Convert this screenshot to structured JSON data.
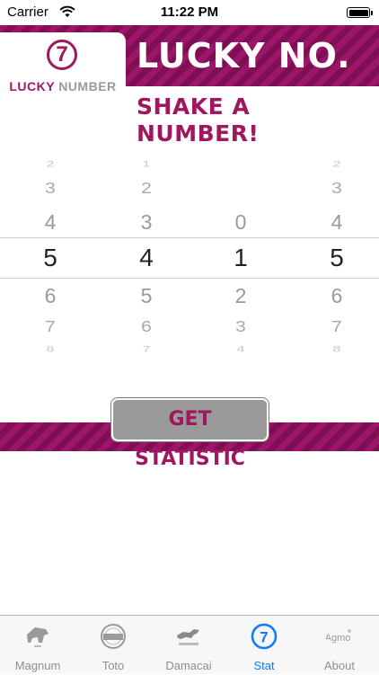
{
  "status_bar": {
    "carrier": "Carrier",
    "time": "11:22 PM",
    "wifi_icon": "wifi-icon",
    "battery_icon": "battery-icon"
  },
  "header": {
    "logo_badge": "7",
    "logo_word1": "LUCKY",
    "logo_word2": "NUMBER",
    "title": "LUCKY NO.",
    "subtitle": "SHAKE A NUMBER!"
  },
  "colors": {
    "brand": "#9b1668",
    "brand_dark": "#7e0f53",
    "button_gray": "#9a9a9a",
    "tab_active": "#0a7aff",
    "tab_inactive": "#8e8e93"
  },
  "picker": {
    "columns": [
      {
        "values": [
          "2",
          "3",
          "4",
          "5",
          "6",
          "7",
          "8"
        ]
      },
      {
        "values": [
          "1",
          "2",
          "3",
          "4",
          "5",
          "6",
          "7"
        ]
      },
      {
        "values": [
          "",
          "",
          "0",
          "1",
          "2",
          "3",
          "4"
        ]
      },
      {
        "values": [
          "2",
          "3",
          "4",
          "5",
          "6",
          "7",
          "8"
        ]
      }
    ],
    "selected": [
      "5",
      "4",
      "1",
      "5"
    ]
  },
  "get_statistic_label": "GET STATISTIC",
  "tabbar": {
    "tabs": [
      {
        "label": "Magnum",
        "icon": "magnum-icon",
        "active": false
      },
      {
        "label": "Toto",
        "icon": "toto-icon",
        "active": false
      },
      {
        "label": "Damacai",
        "icon": "damacai-icon",
        "active": false
      },
      {
        "label": "Stat",
        "icon": "lucky-seven-icon",
        "active": true,
        "badge": "7"
      },
      {
        "label": "About",
        "icon": "agmo-icon",
        "active": false,
        "badge": "Agmo"
      }
    ]
  }
}
